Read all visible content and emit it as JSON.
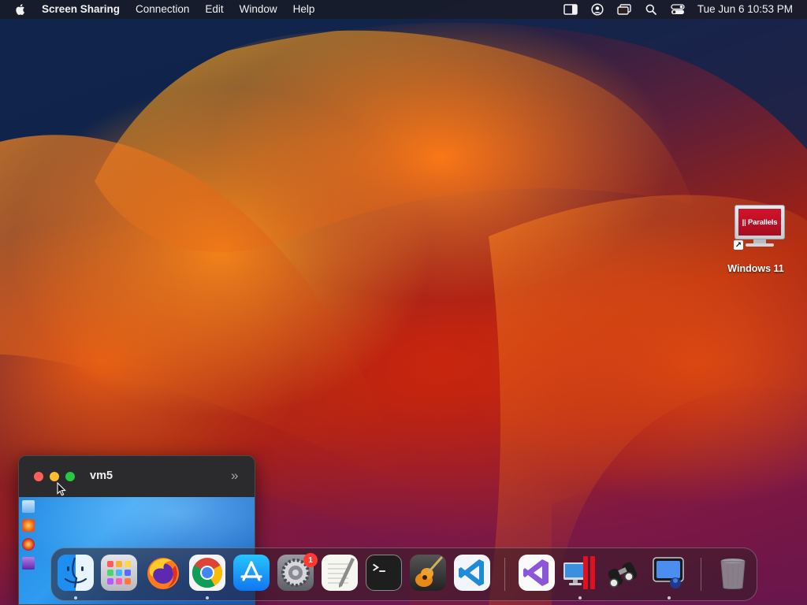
{
  "menubar": {
    "app_name": "Screen Sharing",
    "menus": [
      "Connection",
      "Edit",
      "Window",
      "Help"
    ],
    "clock": "Tue Jun 6  10:53 PM",
    "status_icons": [
      "sidebar-icon",
      "user-icon",
      "screen-mirror-icon",
      "search-icon",
      "control-center-icon"
    ]
  },
  "desktop": {
    "icon_label": "Windows 11",
    "icon_screen_text": "|| Parallels"
  },
  "vm_window": {
    "title": "vm5",
    "chevron": "»"
  },
  "dock": {
    "apps": [
      {
        "name": "Finder",
        "icon": "finder-icon",
        "running": true
      },
      {
        "name": "Launchpad",
        "icon": "launchpad-icon",
        "running": false
      },
      {
        "name": "Firefox",
        "icon": "firefox-icon",
        "running": false
      },
      {
        "name": "Google Chrome",
        "icon": "chrome-icon",
        "running": true
      },
      {
        "name": "App Store",
        "icon": "app-store-icon",
        "running": false
      },
      {
        "name": "System Settings",
        "icon": "settings-icon",
        "running": false,
        "badge": "1"
      },
      {
        "name": "TextEdit",
        "icon": "textedit-icon",
        "running": false
      },
      {
        "name": "Terminal",
        "icon": "terminal-icon",
        "running": false
      },
      {
        "name": "GarageBand",
        "icon": "garageband-icon",
        "running": false
      },
      {
        "name": "Visual Studio Code",
        "icon": "vscode-icon",
        "running": false
      },
      {
        "name": "Visual Studio",
        "icon": "visual-studio-icon",
        "running": false
      },
      {
        "name": "Parallels Desktop",
        "icon": "parallels-icon",
        "running": true
      },
      {
        "name": "Binoculars",
        "icon": "binoculars-icon",
        "running": false
      },
      {
        "name": "Screen Sharing",
        "icon": "screen-sharing-icon",
        "running": true
      },
      {
        "name": "Trash",
        "icon": "trash-icon",
        "running": false
      }
    ]
  },
  "colors": {
    "menubar_text": "#f2f2f2",
    "close": "#ff5f57",
    "minimize": "#febc2e",
    "maximize": "#28c840",
    "badge": "#ff3b30"
  }
}
